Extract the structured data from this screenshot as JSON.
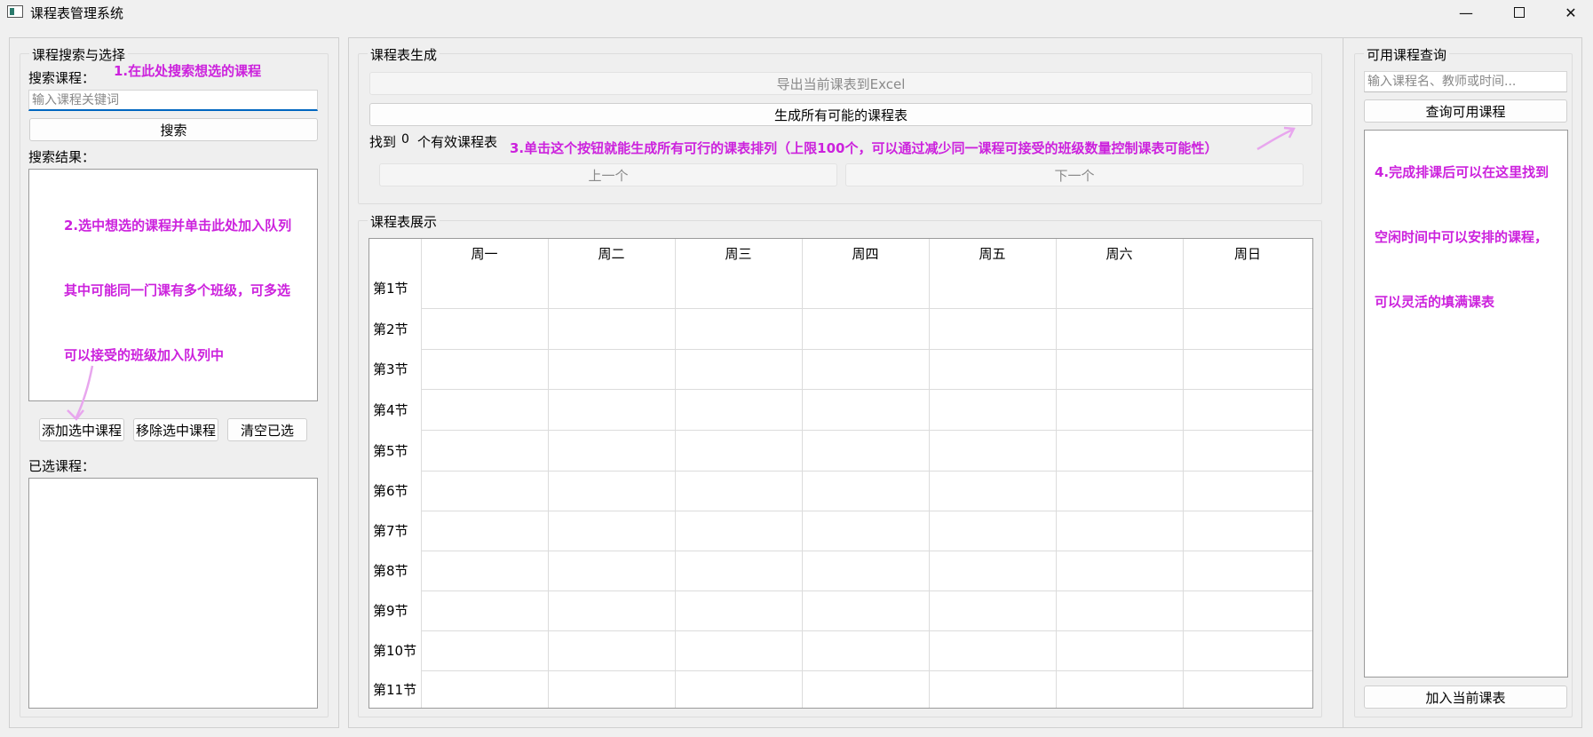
{
  "window": {
    "title": "课程表管理系统"
  },
  "left": {
    "group_title": "课程搜索与选择",
    "search_label": "搜索课程：",
    "search_placeholder": "输入课程关键词",
    "search_button": "搜索",
    "results_label": "搜索结果：",
    "add_button": "添加选中课程",
    "remove_button": "移除选中课程",
    "clear_button": "清空已选",
    "selected_label": "已选课程："
  },
  "middle": {
    "generate_group_title": "课程表生成",
    "export_button": "导出当前课表到Excel",
    "generate_button": "生成所有可能的课程表",
    "found_prefix": "找到",
    "found_count": "0",
    "found_suffix": "个有效课程表",
    "prev_button": "上一个",
    "next_button": "下一个",
    "display_group_title": "课程表展示",
    "days": [
      "周一",
      "周二",
      "周三",
      "周四",
      "周五",
      "周六",
      "周日"
    ],
    "periods": [
      "第1节",
      "第2节",
      "第3节",
      "第4节",
      "第5节",
      "第6节",
      "第7节",
      "第8节",
      "第9节",
      "第10节",
      "第11节"
    ]
  },
  "right": {
    "group_title": "可用课程查询",
    "query_placeholder": "输入课程名、教师或时间...",
    "query_button": "查询可用课程",
    "add_button": "加入当前课表"
  },
  "annotations": {
    "step1": "1.在此处搜索想选的课程",
    "step2_line1": "2.选中想选的课程并单击此处加入队列",
    "step2_line2": "其中可能同一门课有多个班级，可多选",
    "step2_line3": "可以接受的班级加入队列中",
    "step3": "3.单击这个按钮就能生成所有可行的课表排列（上限100个，可以通过减少同一课程可接受的班级数量控制课表可能性）",
    "step4_line1": "4.完成排课后可以在这里找到",
    "step4_line2": "空闲时间中可以安排的课程，",
    "step4_line3": "可以灵活的填满课表"
  },
  "colors": {
    "annotation": "#cc22dd",
    "focus_underline": "#0067c0"
  }
}
